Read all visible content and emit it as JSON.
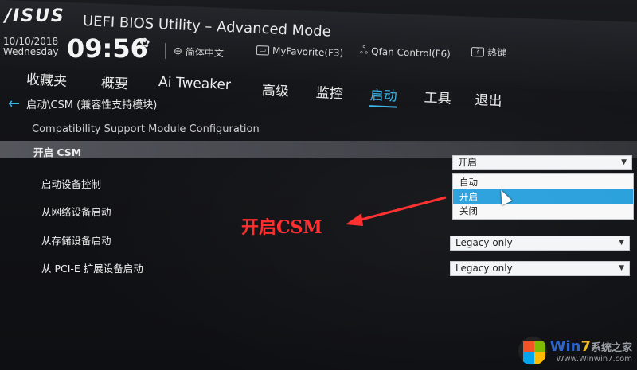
{
  "header": {
    "logo": "/ISUS",
    "title": "UEFI BIOS Utility – Advanced Mode",
    "corner_label": "",
    "date": "10/10/2018",
    "weekday": "Wednesday",
    "time": "09:56",
    "tools": [
      {
        "icon": "globe-icon",
        "label": "简体中文"
      },
      {
        "icon": "favorite-icon",
        "label": "MyFavorite(F3)"
      },
      {
        "icon": "fan-icon",
        "label": "Qfan Control(F6)"
      },
      {
        "icon": "help-icon",
        "label": "热键"
      }
    ]
  },
  "tabs": [
    {
      "label": "收藏夹",
      "active": false
    },
    {
      "label": "概要",
      "active": false
    },
    {
      "label": "Ai Tweaker",
      "active": false
    },
    {
      "label": "高级",
      "active": false
    },
    {
      "label": "监控",
      "active": false
    },
    {
      "label": "启动",
      "active": true
    },
    {
      "label": "工具",
      "active": false
    },
    {
      "label": "退出",
      "active": false
    }
  ],
  "breadcrumb": "启动\\CSM (兼容性支持模块)",
  "subtitle": "Compatibility Support Module Configuration",
  "settings": {
    "csm": {
      "label": "开启 CSM",
      "value": "开启"
    },
    "boot_device_control": {
      "label": "启动设备控制"
    },
    "network_boot": {
      "label": "从网络设备启动"
    },
    "storage_boot": {
      "label": "从存储设备启动",
      "value": "Legacy only"
    },
    "pcie_boot": {
      "label": "从 PCI-E 扩展设备启动",
      "value": "Legacy only"
    }
  },
  "dropdown_options": [
    "自动",
    "开启",
    "关闭"
  ],
  "highlighted_option": "开启",
  "annotation": "开启CSM",
  "watermark": {
    "brand_a": "Win",
    "brand_b": "7",
    "brand_c": "系统之家",
    "url": "Www.Winwin7.com"
  },
  "colors": {
    "accent": "#3ab5ea",
    "highlight": "#28a0dc",
    "annotation": "#ff2a2a"
  }
}
